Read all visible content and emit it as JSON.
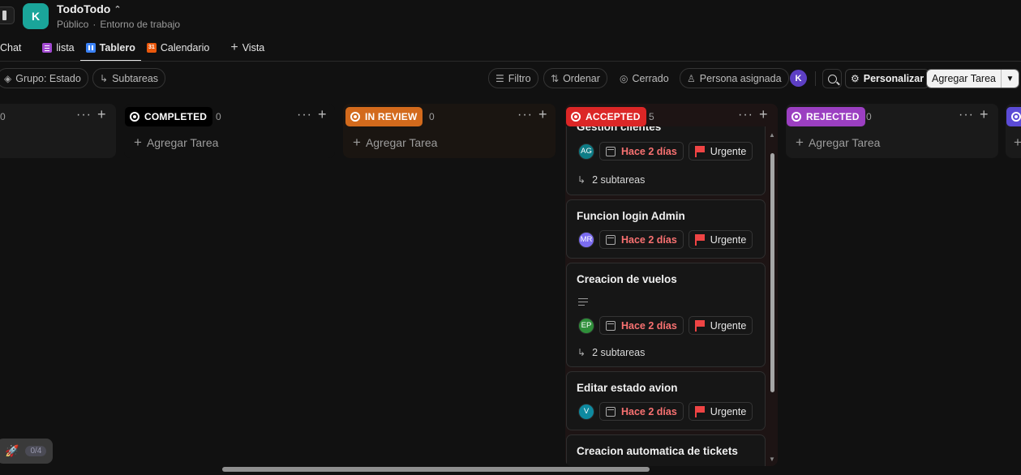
{
  "workspace": {
    "avatar_letter": "K",
    "name": "TodoTodo",
    "visibility": "Público",
    "separator": "·",
    "type": "Entorno de trabajo"
  },
  "tabs": [
    {
      "label": "Chat"
    },
    {
      "label": "lista"
    },
    {
      "label": "Tablero"
    },
    {
      "label": "Calendario",
      "icon_text": "31"
    },
    {
      "label": "Vista"
    }
  ],
  "toolbar": {
    "group": "Grupo: Estado",
    "subtasks": "Subtareas",
    "filter": "Filtro",
    "sort": "Ordenar",
    "closed": "Cerrado",
    "assignee": "Persona asignada",
    "user_initial": "K",
    "customize": "Personalizar",
    "add_task": "Agregar Tarea"
  },
  "columns": [
    {
      "label": "",
      "count": "0",
      "add_label": ""
    },
    {
      "label": "COMPLETED",
      "count": "0",
      "color": "#000000",
      "add_label": "Agregar Tarea"
    },
    {
      "label": "IN REVIEW",
      "count": "0",
      "color": "#d36a1c",
      "add_label": "Agregar Tarea"
    },
    {
      "label": "ACCEPTED",
      "count": "5",
      "color": "#dc2626"
    },
    {
      "label": "REJECTED",
      "count": "0",
      "color": "#9b3fc1",
      "add_label": "Agregar Tarea"
    }
  ],
  "cards": [
    {
      "title": "Gestion clientes",
      "assignee": "AG",
      "assignee_color": "#0e7c86",
      "date": "Hace 2 días",
      "priority": "Urgente",
      "subtasks": "2 subtareas"
    },
    {
      "title": "Funcion login Admin",
      "assignee": "MR",
      "assignee_color": "#7b6cf0",
      "date": "Hace 2 días",
      "priority": "Urgente"
    },
    {
      "title": "Creacion de vuelos",
      "assignee": "EP",
      "assignee_color": "#2f8f3a",
      "date": "Hace 2 días",
      "priority": "Urgente",
      "subtasks": "2 subtareas"
    },
    {
      "title": "Editar estado avion",
      "assignee": "V",
      "assignee_color": "#0e8aa0",
      "date": "Hace 2 días",
      "priority": "Urgente"
    },
    {
      "title": "Creacion automatica de tickets"
    }
  ],
  "onboarding": {
    "progress": "0/4"
  }
}
